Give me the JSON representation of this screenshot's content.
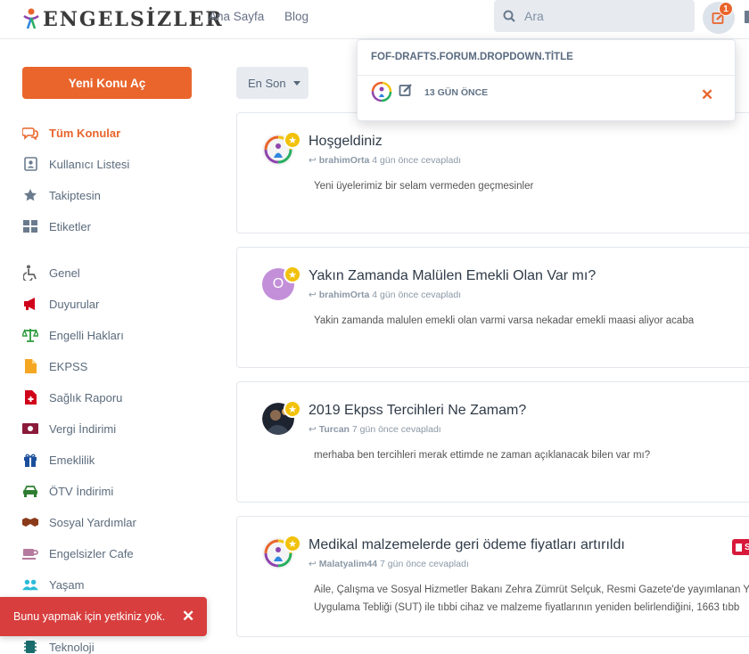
{
  "header": {
    "logo_text": "ENGELSİZLER",
    "nav": [
      "Ana Sayfa",
      "Blog"
    ],
    "search_placeholder": "Ara",
    "notification_count": "1"
  },
  "dropdown": {
    "title": "FOF-DRAFTS.FORUM.DROPDOWN.TİTLE",
    "item_time": "13 GÜN ÖNCE"
  },
  "sidebar": {
    "new_topic_label": "Yeni Konu Aç",
    "primary": [
      {
        "label": "Tüm Konular",
        "icon": "comments-icon"
      },
      {
        "label": "Kullanıcı Listesi",
        "icon": "address-card-icon"
      },
      {
        "label": "Takiptesin",
        "icon": "star-icon"
      },
      {
        "label": "Etiketler",
        "icon": "th-large-icon"
      }
    ],
    "tags": [
      {
        "label": "Genel",
        "icon": "wheelchair-icon",
        "color": "#666666"
      },
      {
        "label": "Duyurular",
        "icon": "megaphone-icon",
        "color": "#d0021b"
      },
      {
        "label": "Engelli Hakları",
        "icon": "balance-scale-icon",
        "color": "#2e9a3e"
      },
      {
        "label": "EKPSS",
        "icon": "file-icon",
        "color": "#f5a623"
      },
      {
        "label": "Sağlık Raporu",
        "icon": "medical-file-icon",
        "color": "#d0021b"
      },
      {
        "label": "Vergi İndirimi",
        "icon": "money-icon",
        "color": "#8b1a3a"
      },
      {
        "label": "Emeklilik",
        "icon": "gift-icon",
        "color": "#1b4f9c"
      },
      {
        "label": "ÖTV İndirimi",
        "icon": "car-icon",
        "color": "#2e7d32"
      },
      {
        "label": "Sosyal Yardımlar",
        "icon": "handshake-icon",
        "color": "#8b3a1a"
      },
      {
        "label": "Engelsizler Cafe",
        "icon": "coffee-icon",
        "color": "#b57a9e"
      },
      {
        "label": "Yaşam",
        "icon": "users-icon",
        "color": "#2bbbd8"
      },
      {
        "label": "Teknoloji",
        "icon": "microchip-icon",
        "color": "#1a6d6d"
      }
    ]
  },
  "sort_label": "En Son",
  "discussions": [
    {
      "title": "Hoşgeldiniz",
      "user": "brahimOrta",
      "when": "4 gün önce cevapladı",
      "excerpt": "Yeni üyelerimiz bir selam vermeden geçmesinler",
      "avatar": "logo"
    },
    {
      "title": "Yakın Zamanda Malülen Emekli Olan Var mı?",
      "user": "brahimOrta",
      "when": "4 gün önce cevapladı",
      "excerpt": "Yakin zamanda malulen emekli olan varmi varsa nekadar emekli maasi aliyor acaba",
      "avatar": "letter",
      "avatar_letter": "O"
    },
    {
      "title": "2019 Ekpss Tercihleri Ne Zamam?",
      "user": "Turcan",
      "when": "7 gün önce cevapladı",
      "excerpt": "merhaba ben tercihleri merak ettimde ne zaman açıklanacak bilen var mı?",
      "avatar": "photo"
    },
    {
      "title": "Medikal malzemelerde geri ödeme fiyatları artırıldı",
      "user": "Malatyalim44",
      "when": "7 gün önce cevapladı",
      "excerpt": "Aile, Çalışma ve Sosyal Hizmetler Bakanı Zehra Zümrüt Selçuk, Resmi Gazete'de yayımlanan Y",
      "excerpt2": "Uygulama Tebliği (SUT) ile tıbbi cihaz ve malzeme fiyatlarının yeniden belirlendiğini, 1663 tıbb",
      "avatar": "logo",
      "tag_badge": "S"
    }
  ],
  "toast": {
    "message": "Bunu yapmak için yetkiniz yok."
  }
}
